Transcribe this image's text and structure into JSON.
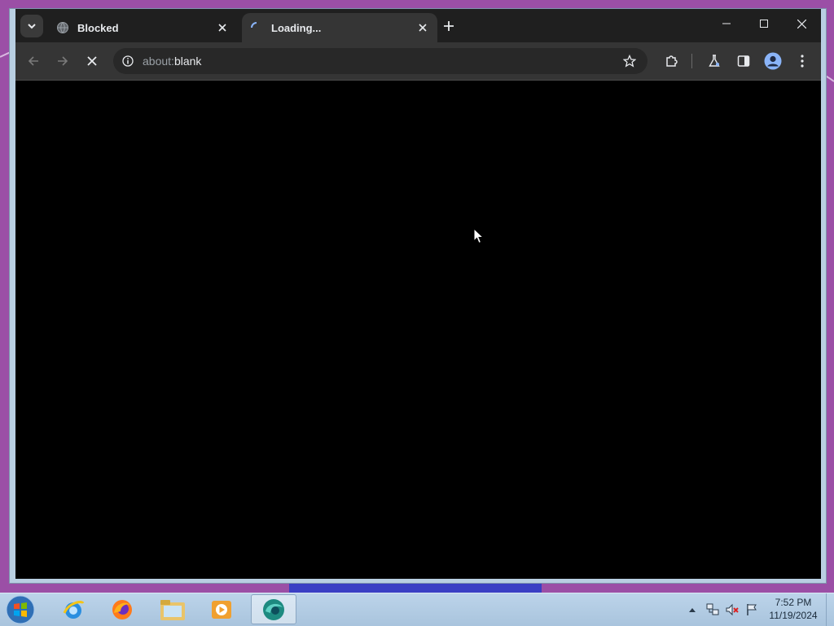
{
  "tabs": [
    {
      "title": "Blocked",
      "favicon": "globe-icon",
      "active": false
    },
    {
      "title": "Loading...",
      "favicon": "loading-spinner-icon",
      "active": true
    }
  ],
  "address_bar": {
    "prefix": "about:",
    "host": "blank"
  },
  "taskbar": {
    "apps": [
      "internet-explorer-icon",
      "firefox-icon",
      "file-explorer-icon",
      "media-player-icon",
      "browser-app-icon"
    ],
    "clock_time": "7:52 PM",
    "clock_date": "11/19/2024"
  },
  "colors": {
    "desktop": "#9b4fa6",
    "tabstrip": "#1f1f1f",
    "toolbar": "#353535",
    "page": "#000000",
    "taskbar": "#b4cde4"
  }
}
